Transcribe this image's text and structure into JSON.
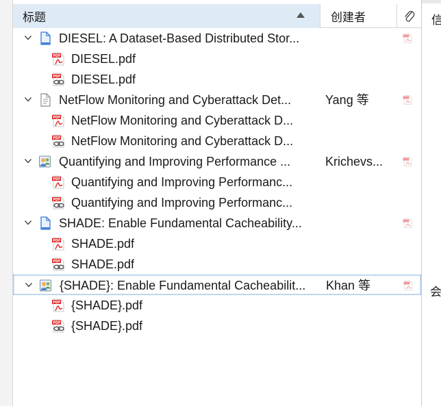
{
  "right_pane": {
    "top_char": "信",
    "mid_char": "会"
  },
  "header": {
    "title_col": "标题",
    "creator_col": "创建者"
  },
  "items": [
    {
      "title": "DIESEL: A Dataset-Based Distributed Stor...",
      "creator": "",
      "icon": "document-icon",
      "children": [
        {
          "title": "DIESEL.pdf",
          "icon": "pdf-icon"
        },
        {
          "title": "DIESEL.pdf",
          "icon": "pdf-link-icon"
        }
      ]
    },
    {
      "title": "NetFlow Monitoring and Cyberattack Det...",
      "creator": "Yang 等",
      "icon": "text-document-icon",
      "children": [
        {
          "title": "NetFlow Monitoring and Cyberattack D...",
          "icon": "pdf-icon"
        },
        {
          "title": "NetFlow Monitoring and Cyberattack D...",
          "icon": "pdf-link-icon"
        }
      ]
    },
    {
      "title": "Quantifying and Improving Performance ...",
      "creator": "Krichevs...",
      "icon": "conference-paper-icon",
      "children": [
        {
          "title": "Quantifying and Improving Performanc...",
          "icon": "pdf-icon"
        },
        {
          "title": "Quantifying and Improving Performanc...",
          "icon": "pdf-link-icon"
        }
      ]
    },
    {
      "title": "SHADE: Enable Fundamental Cacheability...",
      "creator": "",
      "icon": "document-icon",
      "children": [
        {
          "title": "SHADE.pdf",
          "icon": "pdf-icon"
        },
        {
          "title": "SHADE.pdf",
          "icon": "pdf-link-icon"
        }
      ]
    },
    {
      "title": "{SHADE}: Enable Fundamental Cacheabilit...",
      "creator": "Khan 等",
      "icon": "conference-paper-icon",
      "selected": true,
      "children": [
        {
          "title": "{SHADE}.pdf",
          "icon": "pdf-icon"
        },
        {
          "title": "{SHADE}.pdf",
          "icon": "pdf-link-icon"
        }
      ]
    }
  ]
}
